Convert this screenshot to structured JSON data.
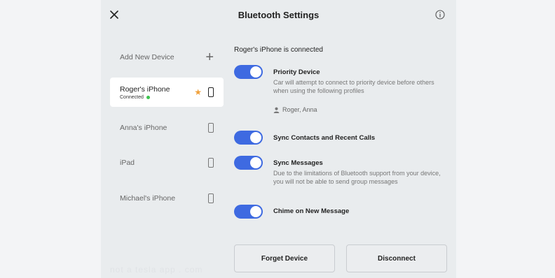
{
  "header": {
    "title": "Bluetooth Settings"
  },
  "sidebar": {
    "add_label": "Add New Device",
    "devices": [
      {
        "name": "Roger's iPhone",
        "status": "Connected"
      },
      {
        "name": "Anna's iPhone"
      },
      {
        "name": "iPad"
      },
      {
        "name": "Michael's iPhone"
      }
    ]
  },
  "main": {
    "connected_message": "Roger's iPhone is connected",
    "settings": [
      {
        "title": "Priority Device",
        "enabled": true,
        "description": "Car will attempt to connect to priority device before others when using the following profiles",
        "profiles": "Roger, Anna"
      },
      {
        "title": "Sync Contacts and Recent Calls",
        "enabled": true
      },
      {
        "title": "Sync Messages",
        "enabled": true,
        "description": "Due to the limitations of Bluetooth support from your device, you will not be able to send group messages"
      },
      {
        "title": "Chime on New Message",
        "enabled": true
      }
    ],
    "forget_label": "Forget Device",
    "disconnect_label": "Disconnect"
  },
  "watermark": "not a tesla app . com",
  "colors": {
    "accent": "#3e6ae1",
    "connected": "#3ec44f",
    "priority_star": "#f0a03a"
  }
}
